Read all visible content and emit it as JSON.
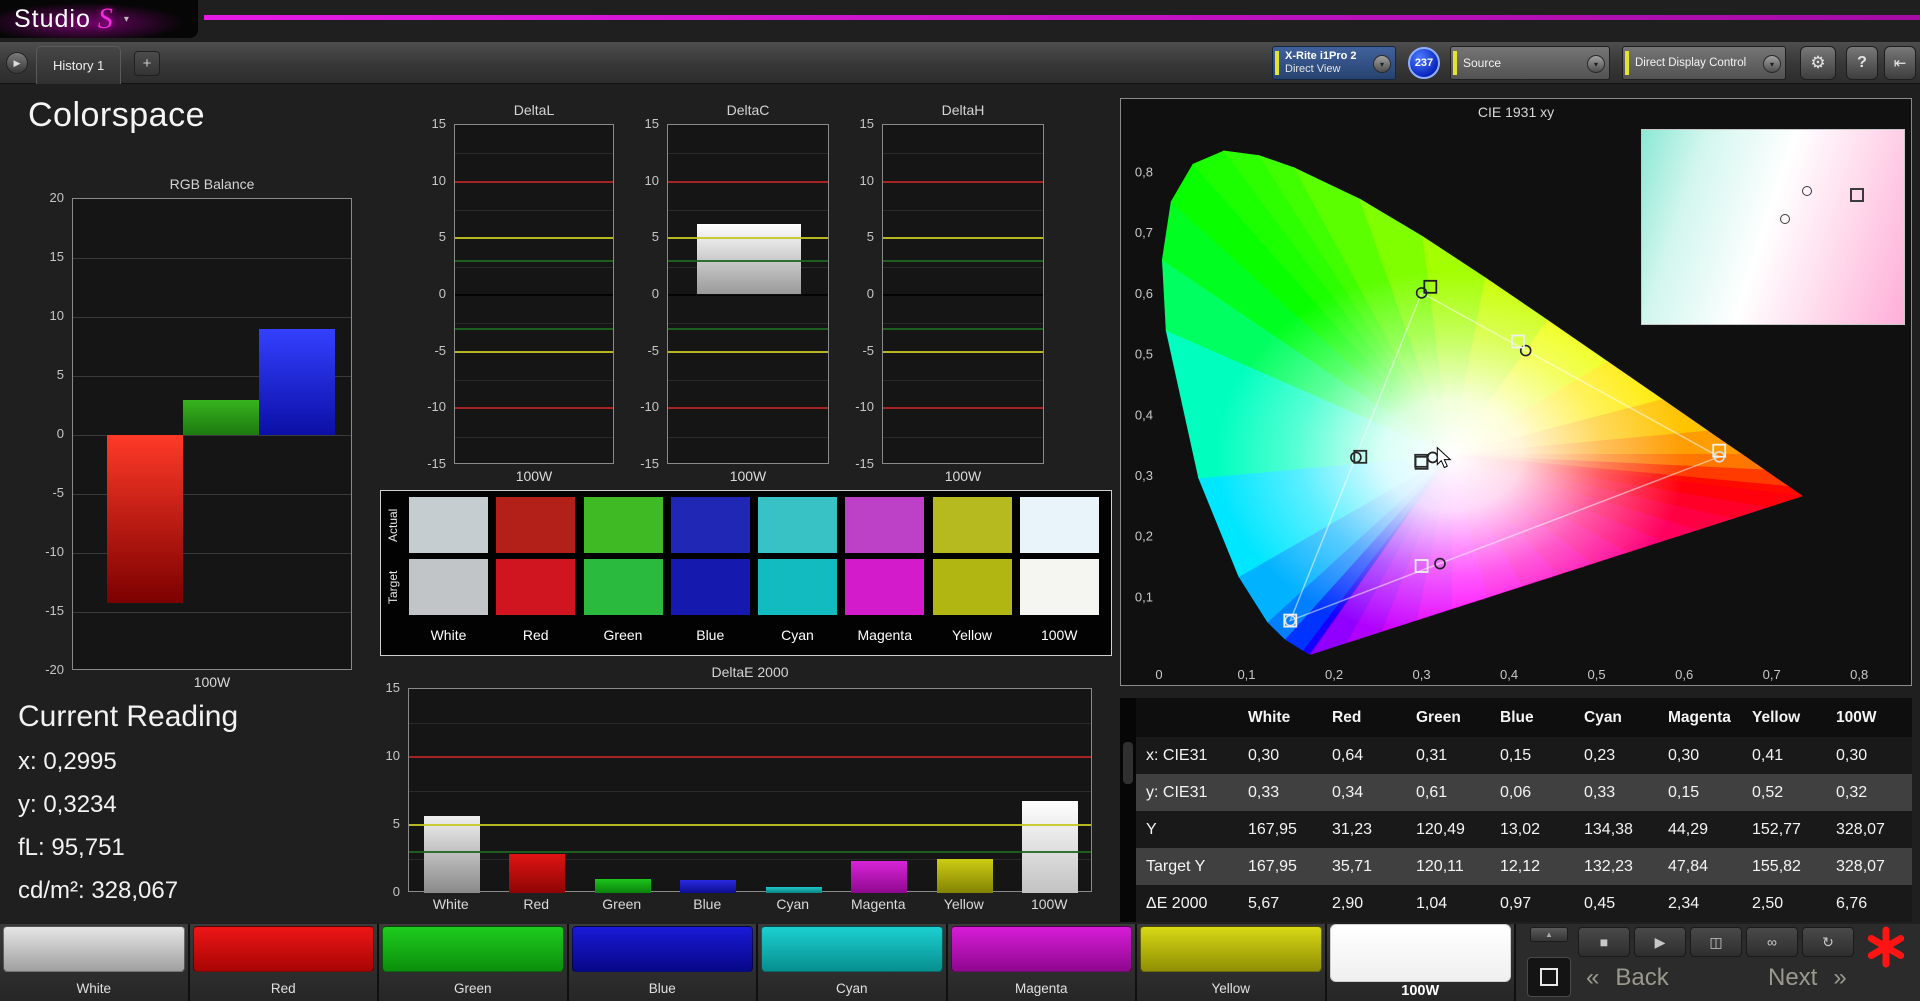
{
  "app": {
    "logo_text": "Studio",
    "logo_mark": "S",
    "caret": "▾",
    "accent_color": "#cc00cc"
  },
  "toolbar": {
    "history_expand_icon": "▶",
    "history_tab": "History 1",
    "add_tab": "+",
    "meter": {
      "line1": "X-Rite i1Pro 2",
      "line2": "Direct View"
    },
    "badge": "237",
    "source_label": "Source",
    "workflow_label": "Direct Display Control",
    "gear_icon": "⚙",
    "help_icon": "?",
    "exit_icon": "⇤",
    "chevron": "▾"
  },
  "page": {
    "title": "Colorspace"
  },
  "current_reading": {
    "title": "Current Reading",
    "lines": [
      {
        "label": "x:",
        "value": "0,2995"
      },
      {
        "label": "y:",
        "value": "0,3234"
      },
      {
        "label": "fL:",
        "value": "95,751"
      },
      {
        "label": "cd/m²:",
        "value": "328,067"
      }
    ]
  },
  "chart_data": {
    "rgb_balance": {
      "type": "bar",
      "title": "RGB Balance",
      "xlabel": "100W",
      "ylim": [
        -20,
        20
      ],
      "tick_step": 5,
      "ref_lines": [],
      "bars": [
        {
          "name": "red",
          "value": -14.2,
          "colors": [
            "#ff3a28",
            "#7c0000"
          ]
        },
        {
          "name": "green",
          "value": 3.0,
          "colors": [
            "#37b31e",
            "#1d7a10"
          ]
        },
        {
          "name": "blue",
          "value": 9.0,
          "colors": [
            "#3440ff",
            "#0b0fa6"
          ]
        }
      ]
    },
    "deltaL": {
      "type": "bar",
      "title": "DeltaL",
      "xlabel": "100W",
      "ylim": [
        -15,
        15
      ],
      "tick_step": 5,
      "ref_lines": [
        {
          "value": 10,
          "color": "#b42424"
        },
        {
          "value": 5,
          "color": "#c6c620"
        },
        {
          "value": 3,
          "color": "#1e651e"
        },
        {
          "value": 0,
          "color": "#000000"
        },
        {
          "value": -3,
          "color": "#1e651e"
        },
        {
          "value": -5,
          "color": "#c6c620"
        },
        {
          "value": -10,
          "color": "#b42424"
        }
      ],
      "bars": []
    },
    "deltaC": {
      "type": "bar",
      "title": "DeltaC",
      "xlabel": "100W",
      "ylim": [
        -15,
        15
      ],
      "tick_step": 5,
      "ref_lines": [
        {
          "value": 10,
          "color": "#b42424"
        },
        {
          "value": 5,
          "color": "#c6c620"
        },
        {
          "value": 3,
          "color": "#1e651e"
        },
        {
          "value": 0,
          "color": "#000000"
        },
        {
          "value": -3,
          "color": "#1e651e"
        },
        {
          "value": -5,
          "color": "#c6c620"
        },
        {
          "value": -10,
          "color": "#b42424"
        }
      ],
      "bars": [
        {
          "name": "deltaC-100W",
          "value": 6.3,
          "colors": [
            "#ffffff",
            "#989898"
          ]
        }
      ]
    },
    "deltaH": {
      "type": "bar",
      "title": "DeltaH",
      "xlabel": "100W",
      "ylim": [
        -15,
        15
      ],
      "tick_step": 5,
      "ref_lines": [
        {
          "value": 10,
          "color": "#b42424"
        },
        {
          "value": 5,
          "color": "#c6c620"
        },
        {
          "value": 3,
          "color": "#1e651e"
        },
        {
          "value": 0,
          "color": "#000000"
        },
        {
          "value": -3,
          "color": "#1e651e"
        },
        {
          "value": -5,
          "color": "#c6c620"
        },
        {
          "value": -10,
          "color": "#b42424"
        }
      ],
      "bars": []
    },
    "deltaE2000": {
      "type": "bar",
      "title": "DeltaE 2000",
      "ylim": [
        0,
        15
      ],
      "tick_step": 5,
      "ref_lines": [
        {
          "value": 10,
          "color": "#b42424"
        },
        {
          "value": 5,
          "color": "#c6c620"
        },
        {
          "value": 3,
          "color": "#1e651e"
        }
      ],
      "categories": [
        "White",
        "Red",
        "Green",
        "Blue",
        "Cyan",
        "Magenta",
        "Yellow",
        "100W"
      ],
      "bars": [
        {
          "name": "White",
          "value": 5.67,
          "colors": [
            "#f0f0f0",
            "#8a8a8a"
          ]
        },
        {
          "name": "Red",
          "value": 2.9,
          "colors": [
            "#e01414",
            "#8f0404"
          ]
        },
        {
          "name": "Green",
          "value": 1.04,
          "colors": [
            "#1ec41e",
            "#0b830b"
          ]
        },
        {
          "name": "Blue",
          "value": 0.97,
          "colors": [
            "#2a2ae0",
            "#0d0d8f"
          ]
        },
        {
          "name": "Cyan",
          "value": 0.45,
          "colors": [
            "#1ec8c8",
            "#0b8383"
          ]
        },
        {
          "name": "Magenta",
          "value": 2.34,
          "colors": [
            "#d824d8",
            "#8f088f"
          ]
        },
        {
          "name": "Yellow",
          "value": 2.5,
          "colors": [
            "#cccc14",
            "#838304"
          ]
        },
        {
          "name": "100W",
          "value": 6.76,
          "colors": [
            "#ffffff",
            "#c2c2c2"
          ]
        }
      ]
    },
    "cie": {
      "type": "scatter",
      "title": "CIE 1931 xy",
      "xlim": [
        0,
        0.85
      ],
      "ylim": [
        0,
        0.88
      ],
      "xtick_labels": [
        "0",
        "0,1",
        "0,2",
        "0,3",
        "0,4",
        "0,5",
        "0,6",
        "0,7",
        "0,8"
      ],
      "ytick_labels": [
        "0,1",
        "0,2",
        "0,3",
        "0,4",
        "0,5",
        "0,6",
        "0,7",
        "0,8"
      ],
      "points": [
        {
          "name": "white",
          "measured": [
            0.2995,
            0.3234
          ],
          "target": [
            0.3127,
            0.329
          ],
          "measured_stroke": "#2a2a2a",
          "target_stroke": "#222222"
        },
        {
          "name": "red",
          "measured": [
            0.64,
            0.34
          ],
          "target": [
            0.64,
            0.33
          ],
          "measured_stroke": "#f0f0f0",
          "target_stroke": "#dddddd"
        },
        {
          "name": "green",
          "measured": [
            0.31,
            0.61
          ],
          "target": [
            0.3,
            0.6
          ],
          "measured_stroke": "#1f1f1f",
          "target_stroke": "#222222"
        },
        {
          "name": "blue",
          "measured": [
            0.15,
            0.06
          ],
          "target": [
            0.15,
            0.06
          ],
          "measured_stroke": "#f0f0f0",
          "target_stroke": "#dddddd"
        },
        {
          "name": "cyan",
          "measured": [
            0.23,
            0.33
          ],
          "target": [
            0.225,
            0.329
          ],
          "measured_stroke": "#2a2a2a",
          "target_stroke": "#222222"
        },
        {
          "name": "magenta",
          "measured": [
            0.3,
            0.15
          ],
          "target": [
            0.321,
            0.154
          ],
          "measured_stroke": "#f0f0f0",
          "target_stroke": "#222222"
        },
        {
          "name": "yellow",
          "measured": [
            0.41,
            0.52
          ],
          "target": [
            0.419,
            0.505
          ],
          "measured_stroke": "#f0f0f0",
          "target_stroke": "#222222"
        },
        {
          "name": "100W",
          "measured": [
            0.3,
            0.32
          ],
          "target": [
            0.3127,
            0.329
          ],
          "measured_stroke": "#2a2a2a",
          "target_stroke": "#222222"
        }
      ],
      "gamut_triangle": [
        [
          0.64,
          0.33
        ],
        [
          0.3,
          0.6
        ],
        [
          0.15,
          0.06
        ]
      ]
    }
  },
  "swatch_panel": {
    "row_labels": [
      "Actual",
      "Target"
    ],
    "columns": [
      "White",
      "Red",
      "Green",
      "Blue",
      "Cyan",
      "Magenta",
      "Yellow",
      "100W"
    ],
    "actual_colors": [
      "#c6cdd1",
      "#b32019",
      "#3fba25",
      "#2127b5",
      "#38c2c6",
      "#bc41c6",
      "#b6ba1f",
      "#e9f4fa"
    ],
    "target_colors": [
      "#c1c5c7",
      "#d01420",
      "#2abb3e",
      "#1519ad",
      "#12bbbf",
      "#d31bcb",
      "#b2b612",
      "#f5f5f1"
    ]
  },
  "measurement_table": {
    "header": [
      "White",
      "Red",
      "Green",
      "Blue",
      "Cyan",
      "Magenta",
      "Yellow",
      "100W"
    ],
    "rows": [
      {
        "label": "x: CIE31",
        "values": [
          "0,30",
          "0,64",
          "0,31",
          "0,15",
          "0,23",
          "0,30",
          "0,41",
          "0,30"
        ]
      },
      {
        "label": "y: CIE31",
        "values": [
          "0,33",
          "0,34",
          "0,61",
          "0,06",
          "0,33",
          "0,15",
          "0,52",
          "0,32"
        ]
      },
      {
        "label": "Y",
        "values": [
          "167,95",
          "31,23",
          "120,49",
          "13,02",
          "134,38",
          "44,29",
          "152,77",
          "328,07"
        ]
      },
      {
        "label": "Target Y",
        "values": [
          "167,95",
          "35,71",
          "120,11",
          "12,12",
          "132,23",
          "47,84",
          "155,82",
          "328,07"
        ]
      },
      {
        "label": "ΔE 2000",
        "values": [
          "5,67",
          "2,90",
          "1,04",
          "0,97",
          "0,45",
          "2,34",
          "2,50",
          "6,76"
        ]
      }
    ]
  },
  "color_bank": {
    "buttons": [
      {
        "label": "White",
        "colors": [
          "#e6e6e6",
          "#a0a0a0"
        ],
        "selected": false
      },
      {
        "label": "Red",
        "colors": [
          "#ee1616",
          "#a80404"
        ],
        "selected": false
      },
      {
        "label": "Green",
        "colors": [
          "#1ecc1e",
          "#0b8f0b"
        ],
        "selected": false
      },
      {
        "label": "Blue",
        "colors": [
          "#1a1ad8",
          "#070788"
        ],
        "selected": false
      },
      {
        "label": "Cyan",
        "colors": [
          "#1cd0d0",
          "#078f8f"
        ],
        "selected": false
      },
      {
        "label": "Magenta",
        "colors": [
          "#d81cd8",
          "#8f078f"
        ],
        "selected": false
      },
      {
        "label": "Yellow",
        "colors": [
          "#d8d816",
          "#8f8f04"
        ],
        "selected": false
      },
      {
        "label": "100W",
        "colors": [
          "#ffffff",
          "#f0f0f0"
        ],
        "selected": true
      }
    ]
  },
  "transport": {
    "scroll_up_icon": "▲",
    "buttons": [
      {
        "name": "stop"
      },
      {
        "name": "play"
      },
      {
        "name": "single-measure"
      },
      {
        "name": "continuous-measure"
      },
      {
        "name": "reset"
      }
    ]
  },
  "nav": {
    "back_chevron": "«",
    "back": "Back",
    "next": "Next",
    "next_chevron": "»"
  }
}
